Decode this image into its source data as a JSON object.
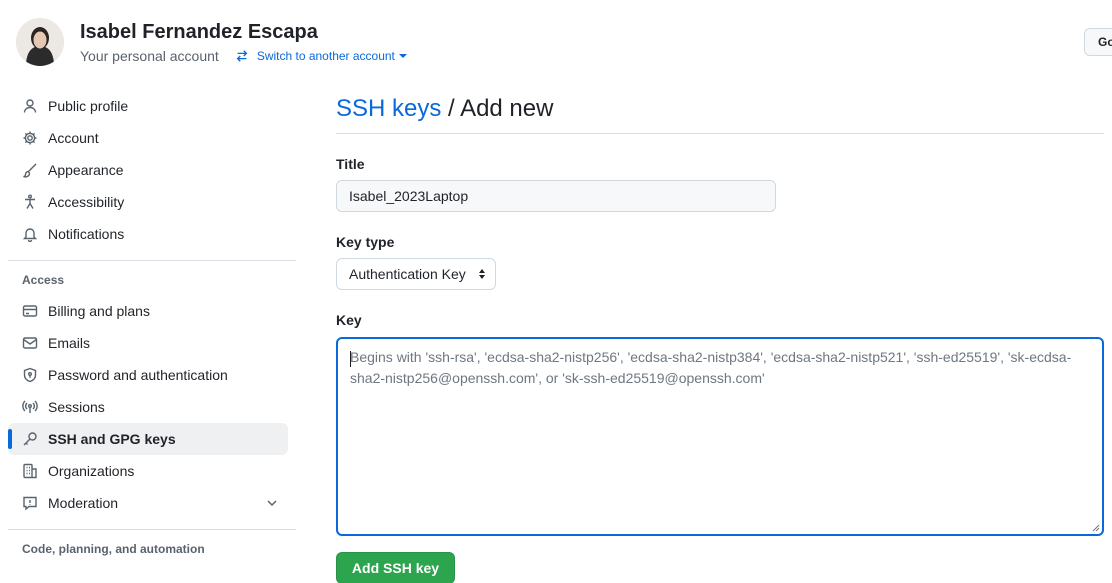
{
  "header": {
    "user_name": "Isabel Fernandez Escapa",
    "account_type": "Your personal account",
    "switch_label": "Switch to another account",
    "go_button": "Go"
  },
  "sidebar": {
    "items": [
      {
        "label": "Public profile",
        "icon": "person-icon"
      },
      {
        "label": "Account",
        "icon": "gear-icon"
      },
      {
        "label": "Appearance",
        "icon": "paintbrush-icon"
      },
      {
        "label": "Accessibility",
        "icon": "accessibility-icon"
      },
      {
        "label": "Notifications",
        "icon": "bell-icon"
      }
    ],
    "access_title": "Access",
    "access_items": [
      {
        "label": "Billing and plans",
        "icon": "credit-card-icon"
      },
      {
        "label": "Emails",
        "icon": "mail-icon"
      },
      {
        "label": "Password and authentication",
        "icon": "shield-lock-icon"
      },
      {
        "label": "Sessions",
        "icon": "broadcast-icon"
      },
      {
        "label": "SSH and GPG keys",
        "icon": "key-icon",
        "active": true
      },
      {
        "label": "Organizations",
        "icon": "organization-icon"
      },
      {
        "label": "Moderation",
        "icon": "report-icon"
      }
    ],
    "code_title": "Code, planning, and automation"
  },
  "main": {
    "breadcrumb": "SSH keys",
    "separator": " / ",
    "page_title": "Add new",
    "title_label": "Title",
    "title_value": "Isabel_2023Laptop",
    "key_type_label": "Key type",
    "key_type_value": "Authentication Key",
    "key_label": "Key",
    "key_placeholder": "Begins with 'ssh-rsa', 'ecdsa-sha2-nistp256', 'ecdsa-sha2-nistp384', 'ecdsa-sha2-nistp521', 'ssh-ed25519', 'sk-ecdsa-sha2-nistp256@openssh.com', or 'sk-ssh-ed25519@openssh.com'",
    "submit_label": "Add SSH key"
  },
  "colors": {
    "link": "#0969da",
    "primary_button": "#2da44e",
    "active_indicator": "#0969da"
  }
}
